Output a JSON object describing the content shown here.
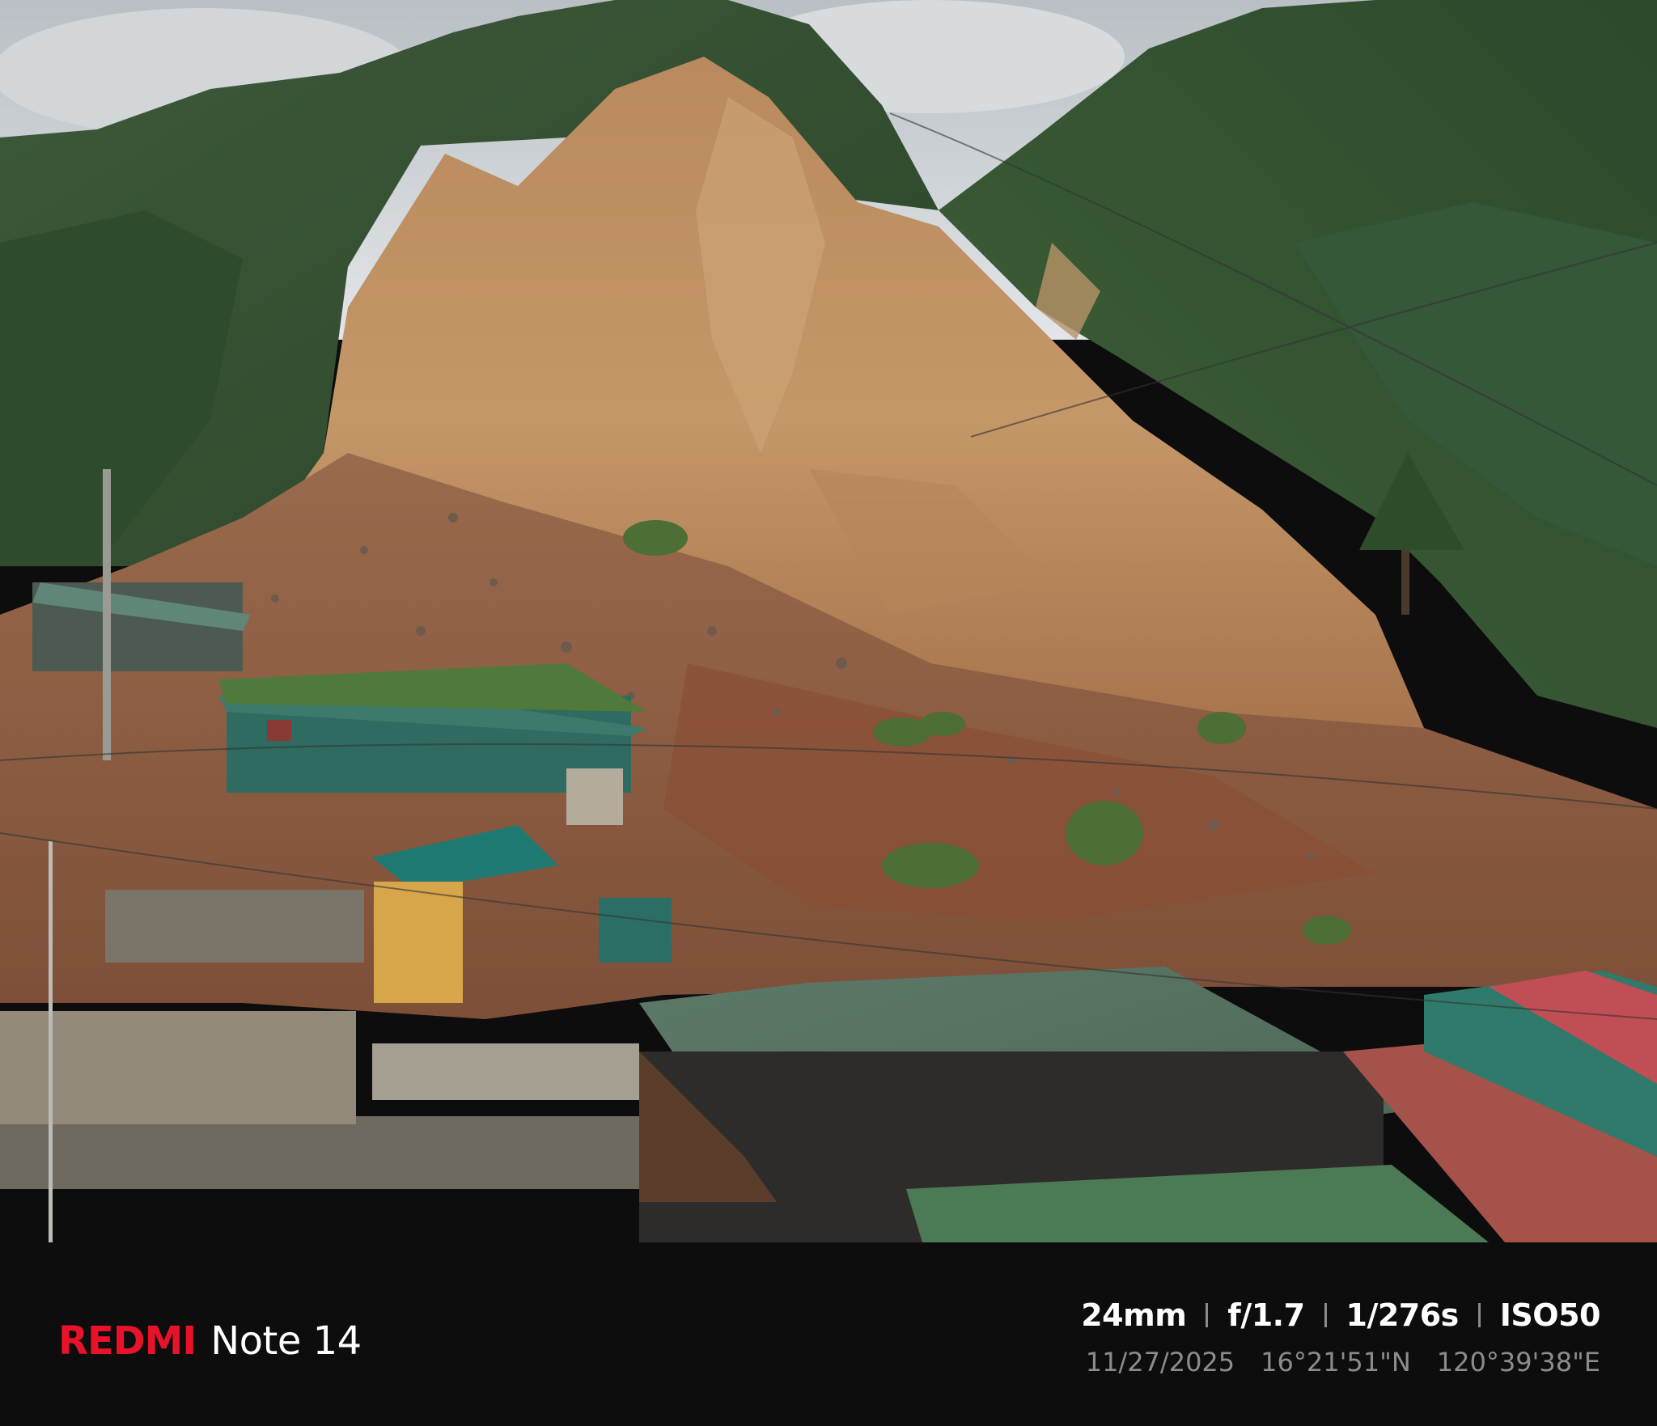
{
  "photo": {
    "subject": ""
  },
  "watermark": {
    "brand": "REDMI",
    "model": "Note 14",
    "brand_color": "#e8132a",
    "focal_length": "24mm",
    "aperture": "f/1.7",
    "shutter": "1/276s",
    "iso": "ISO50",
    "date": "11/27/2025",
    "latitude": "16°21'51\"N",
    "longitude": "120°39'38\"E"
  }
}
